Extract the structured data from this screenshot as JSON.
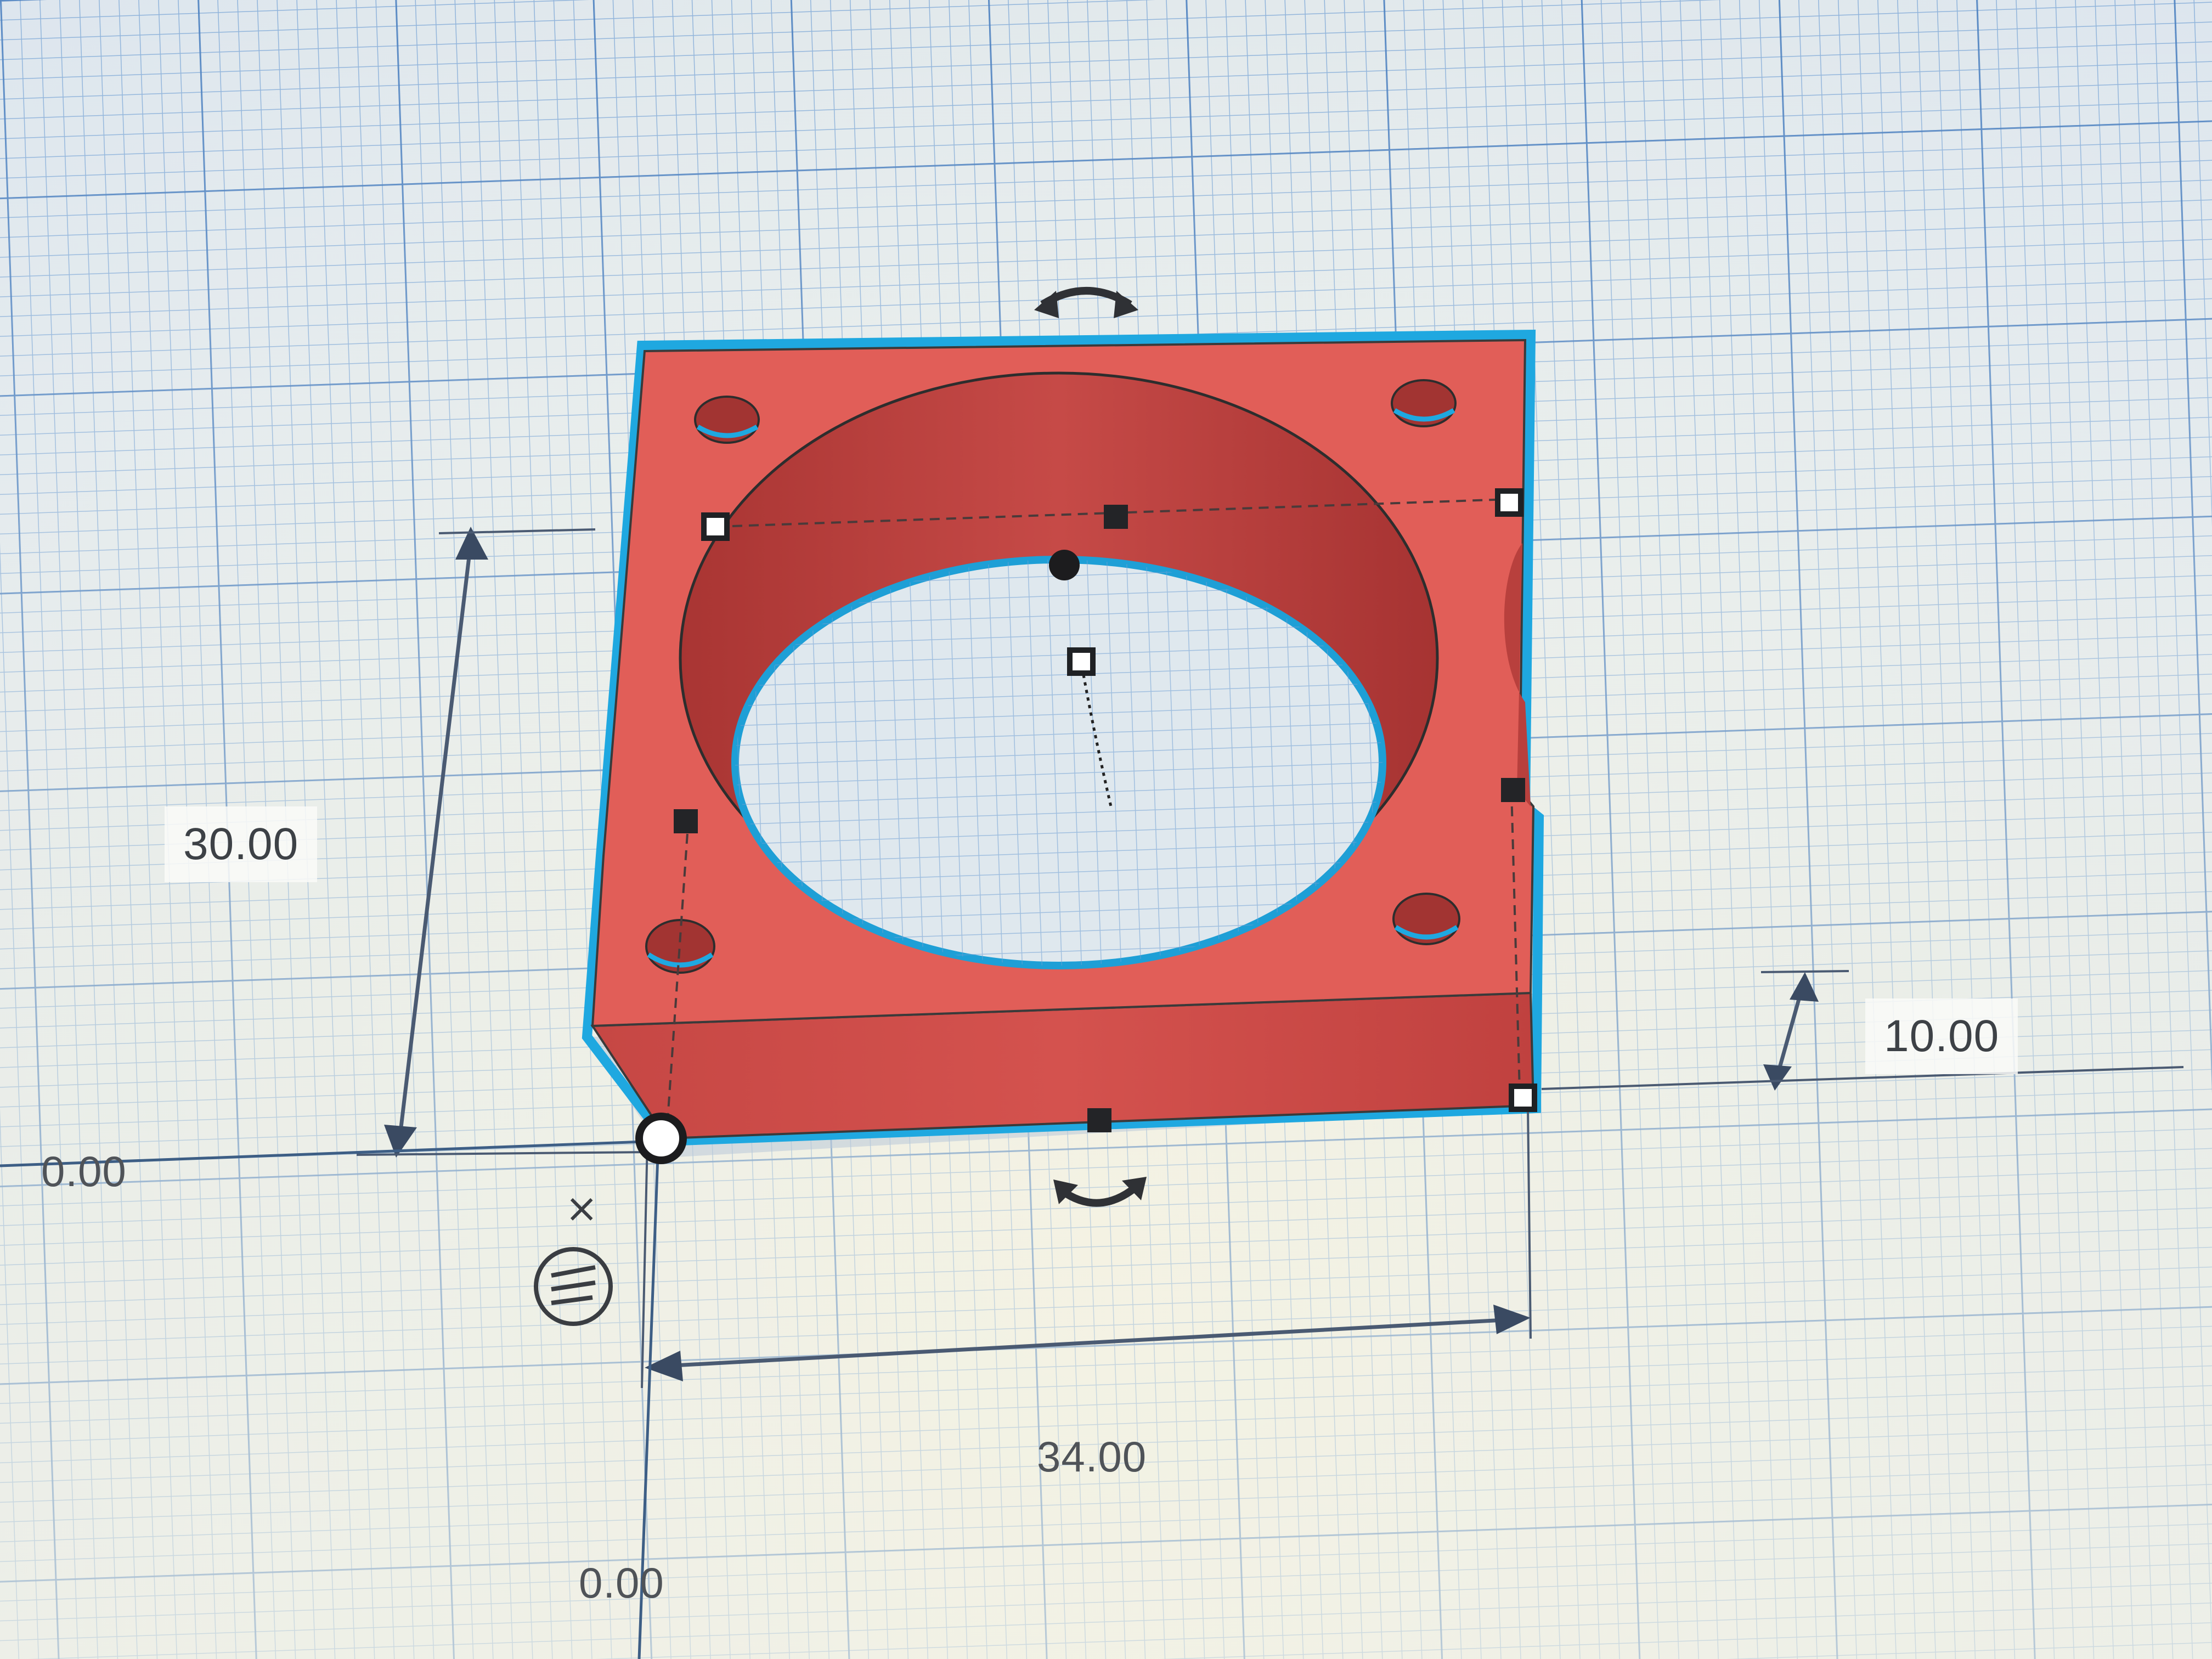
{
  "workplane": {
    "grid_color": "#4b86c9",
    "background": "#e6ecef"
  },
  "shape": {
    "color": "#e05a55",
    "side_color": "#c94845",
    "selection_outline": "#1fa8e0"
  },
  "dimensions": {
    "length": "30.00",
    "width": "34.00",
    "height": "10.00",
    "origin_x": "0.00",
    "origin_y": "0.00"
  },
  "icons": {
    "rotate_top": "rotate-arrow-icon",
    "rotate_bottom": "rotate-arrow-icon",
    "close": "close-icon",
    "snap": "snap-grid-icon"
  }
}
